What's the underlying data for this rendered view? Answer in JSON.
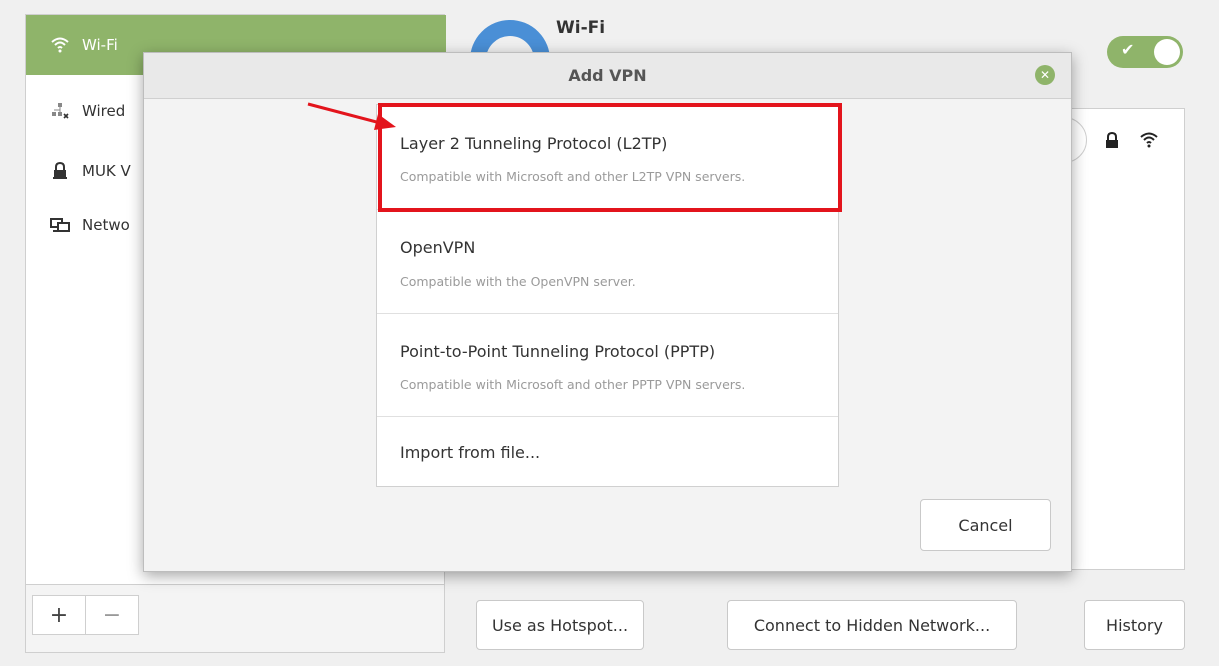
{
  "sidebar": {
    "items": [
      {
        "label": "Wi-Fi",
        "icon": "wifi-icon",
        "active": true
      },
      {
        "label": "Wired",
        "icon": "wired-network-icon",
        "active": false
      },
      {
        "label": "MUK V",
        "icon": "vpn-lock-icon",
        "active": false
      },
      {
        "label": "Netwo",
        "icon": "network-proxy-icon",
        "active": false
      }
    ],
    "add_symbol": "+",
    "remove_symbol": "−"
  },
  "main": {
    "title": "Wi-Fi",
    "toggle_on": true,
    "toggle_check": "✔",
    "buttons": {
      "hotspot": "Use as Hotspot...",
      "hidden_network": "Connect to Hidden Network...",
      "history": "History"
    }
  },
  "dialog": {
    "title": "Add VPN",
    "close_symbol": "✕",
    "options": [
      {
        "title": "Layer 2 Tunneling Protocol (L2TP)",
        "description": "Compatible with Microsoft and other L2TP VPN servers."
      },
      {
        "title": "OpenVPN",
        "description": "Compatible with the OpenVPN server."
      },
      {
        "title": "Point-to-Point Tunneling Protocol (PPTP)",
        "description": "Compatible with Microsoft and other PPTP VPN servers."
      },
      {
        "title": "Import from file...",
        "description": ""
      }
    ],
    "cancel_label": "Cancel"
  },
  "colors": {
    "accent_green": "#8fb46a",
    "highlight_red": "#e3141c",
    "wifi_blue": "#4a8fd6"
  }
}
